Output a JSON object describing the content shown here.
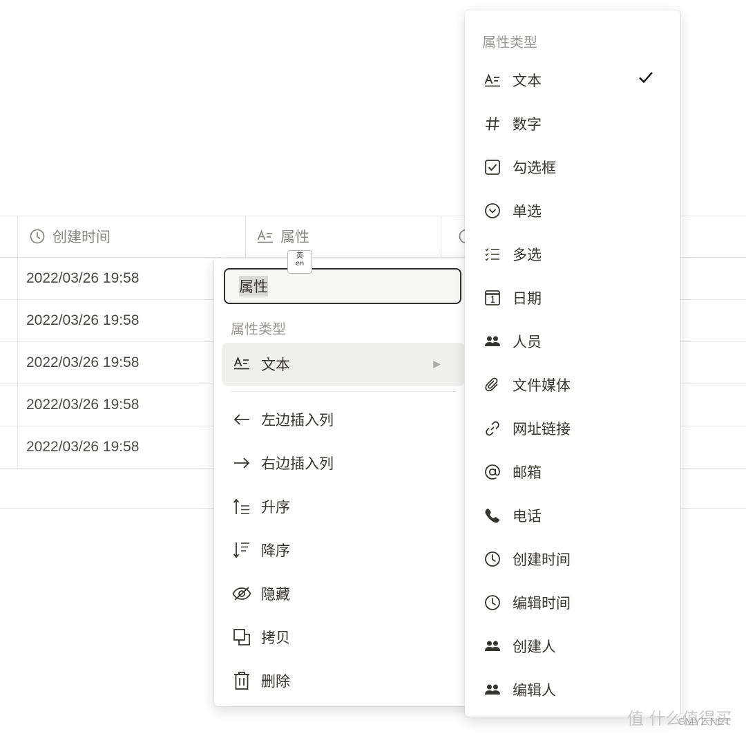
{
  "table": {
    "headers": [
      {
        "icon": "clock-icon",
        "label": "创建时间"
      },
      {
        "icon": "text-type-icon",
        "label": "属性"
      }
    ],
    "rows": [
      "2022/03/26 19:58",
      "2022/03/26 19:58",
      "2022/03/26 19:58",
      "2022/03/26 19:58",
      "2022/03/26 19:58"
    ]
  },
  "column_menu": {
    "name_value": "属性",
    "ime_badge_top": "英",
    "ime_badge_bottom": "en",
    "type_section_label": "属性类型",
    "current_type": {
      "icon": "text-type-icon",
      "label": "文本"
    },
    "actions": [
      {
        "icon": "arrow-left-icon",
        "label": "左边插入列"
      },
      {
        "icon": "arrow-right-icon",
        "label": "右边插入列"
      },
      {
        "icon": "sort-ascending-icon",
        "label": "升序"
      },
      {
        "icon": "sort-descending-icon",
        "label": "降序"
      },
      {
        "icon": "eye-off-icon",
        "label": "隐藏"
      },
      {
        "icon": "copy-icon",
        "label": "拷贝"
      },
      {
        "icon": "trash-icon",
        "label": "删除"
      }
    ]
  },
  "type_menu": {
    "section_label": "属性类型",
    "selected_index": 0,
    "items": [
      {
        "icon": "text-type-icon",
        "label": "文本"
      },
      {
        "icon": "hash-icon",
        "label": "数字"
      },
      {
        "icon": "checkbox-icon",
        "label": "勾选框"
      },
      {
        "icon": "chevron-circle-icon",
        "label": "单选"
      },
      {
        "icon": "list-icon",
        "label": "多选"
      },
      {
        "icon": "calendar-icon",
        "label": "日期"
      },
      {
        "icon": "people-icon",
        "label": "人员"
      },
      {
        "icon": "paperclip-icon",
        "label": "文件媒体"
      },
      {
        "icon": "link-icon",
        "label": "网址链接"
      },
      {
        "icon": "at-icon",
        "label": "邮箱"
      },
      {
        "icon": "phone-icon",
        "label": "电话"
      },
      {
        "icon": "clock-icon",
        "label": "创建时间"
      },
      {
        "icon": "clock-icon",
        "label": "编辑时间"
      },
      {
        "icon": "people-icon",
        "label": "创建人"
      },
      {
        "icon": "people-icon",
        "label": "编辑人"
      }
    ]
  },
  "watermark": {
    "text": "值 什么值得买",
    "site": "SMYZ.NET"
  }
}
